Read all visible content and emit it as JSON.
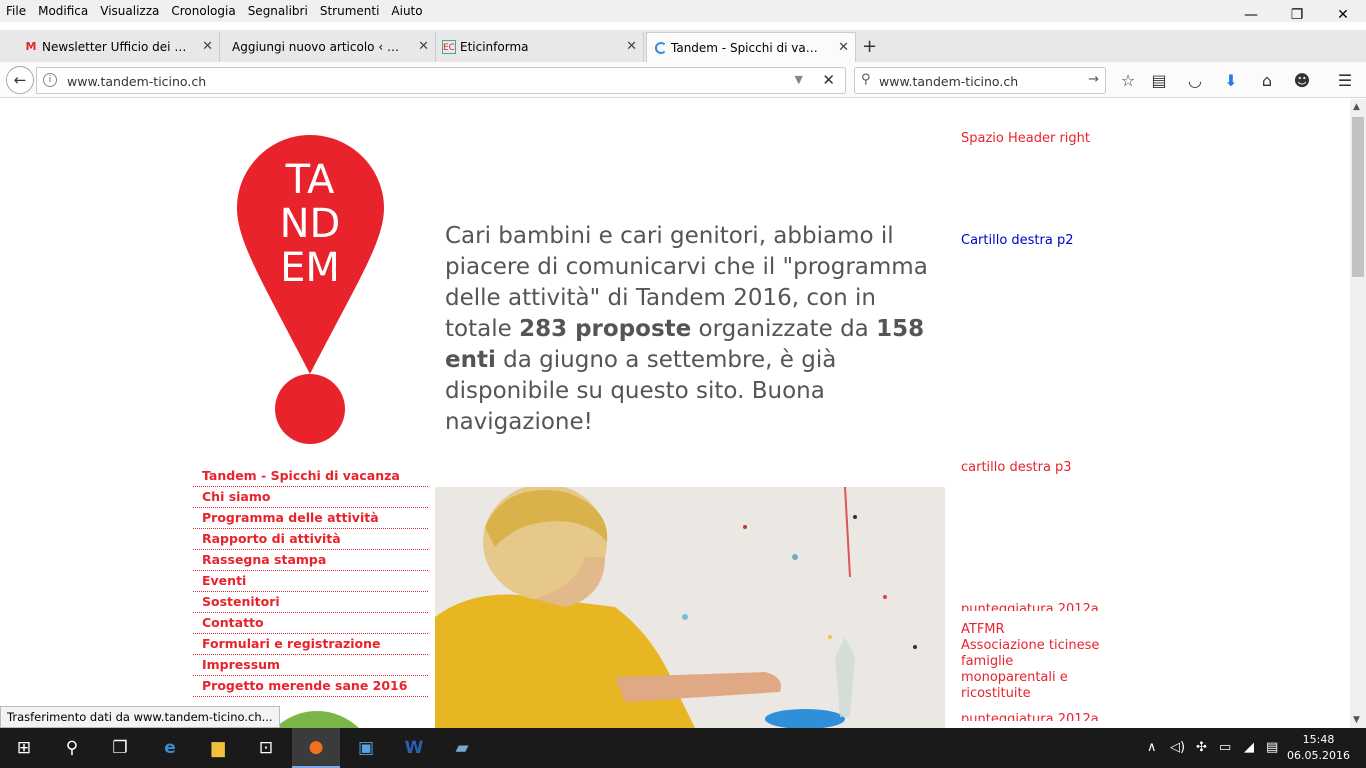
{
  "menubar": [
    "File",
    "Modifica",
    "Visualizza",
    "Cronologia",
    "Segnalibri",
    "Strumenti",
    "Aiuto"
  ],
  "window_controls": {
    "minimize": "—",
    "restore": "❐",
    "close": "✕"
  },
  "tabs": [
    {
      "title": "Newsletter Ufficio dei giov...",
      "favicon": "gmail-icon"
    },
    {
      "title": "Aggiungi nuovo articolo ‹ Etici...",
      "favicon": "wordpress-icon"
    },
    {
      "title": "Eticinforma",
      "favicon": "eticinforma-icon"
    },
    {
      "title": "Tandem - Spicchi di vaca...",
      "favicon": "loading-icon",
      "active": true
    }
  ],
  "navbar": {
    "url": "www.tandem-ticino.ch",
    "search": "www.tandem-ticino.ch"
  },
  "page": {
    "logo_letters": [
      "TA",
      "ND",
      "EM"
    ],
    "intro_parts": {
      "p1": "Cari bambini e cari genitori, abbiamo il piacere di comunicarvi che il \"programma delle attività\" di Tandem 2016, con in totale ",
      "b1": "283 proposte",
      "p2": " organizzate da ",
      "b2": "158 enti",
      "p3": " da giugno a settembre, è già disponibile su questo sito. Buona navigazione!"
    },
    "menu": [
      "Tandem - Spicchi di vacanza",
      "Chi siamo",
      "Programma delle attività",
      "Rapporto di attività",
      "Rassegna stampa",
      "Eventi",
      "Sostenitori",
      "Contatto",
      "Formulari e registrazione",
      "Impressum",
      "Progetto merende sane 2016"
    ],
    "sidebar": {
      "header_right": "Spazio Header right",
      "cartillo_p2": "Cartillo destra p2",
      "cartillo_p3": "cartillo destra p3",
      "punteggiatura": "punteggiatura 2012a",
      "atfmr_title": "ATFMR",
      "atfmr_text": "Associazione ticinese famiglie monoparentali e ricostituite"
    }
  },
  "statusbar": "Trasferimento dati da www.tandem-ticino.ch...",
  "taskbar": {
    "time": "15:48",
    "date": "06.05.2016"
  },
  "colors": {
    "brand_red": "#e8232c",
    "link_blue": "#0000cc"
  }
}
